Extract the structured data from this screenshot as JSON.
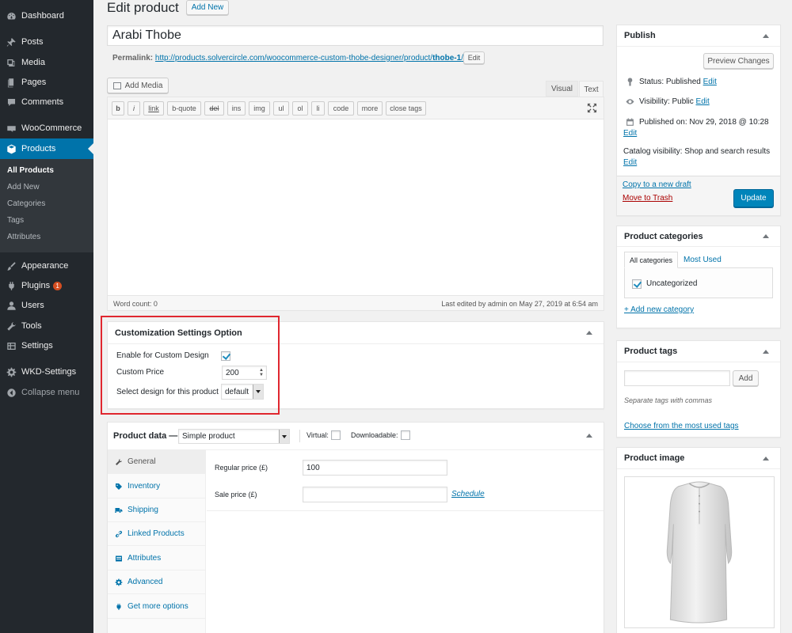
{
  "sidebar": {
    "items": [
      {
        "label": "Dashboard",
        "icon": "dashboard-icon"
      },
      {
        "label": "Posts",
        "icon": "pin-icon"
      },
      {
        "label": "Media",
        "icon": "media-icon"
      },
      {
        "label": "Pages",
        "icon": "pages-icon"
      },
      {
        "label": "Comments",
        "icon": "comment-icon"
      },
      {
        "label": "WooCommerce",
        "icon": "woocommerce-icon"
      },
      {
        "label": "Products",
        "icon": "products-box-icon"
      },
      {
        "label": "Appearance",
        "icon": "paintbrush-icon"
      },
      {
        "label": "Plugins",
        "icon": "plug-icon",
        "badge": "1"
      },
      {
        "label": "Users",
        "icon": "user-icon"
      },
      {
        "label": "Tools",
        "icon": "wrench-icon"
      },
      {
        "label": "Settings",
        "icon": "settings-icon"
      },
      {
        "label": "WKD-Settings",
        "icon": "gear-icon"
      }
    ],
    "submenu": [
      "All Products",
      "Add New",
      "Categories",
      "Tags",
      "Attributes"
    ],
    "collapse_label": "Collapse menu"
  },
  "header": {
    "title": "Edit product",
    "add_new": "Add New"
  },
  "title_input": {
    "value": "Arabi Thobe"
  },
  "permalink": {
    "label": "Permalink:",
    "url_prefix": "http://products.solvercircle.com/woocommerce-custom-thobe-designer/product/",
    "slug": "thobe-1",
    "url_suffix": "/",
    "edit_label": "Edit"
  },
  "editor": {
    "add_media": "Add Media",
    "tab_visual": "Visual",
    "tab_text": "Text",
    "quicktags": [
      "b",
      "i",
      "link",
      "b-quote",
      "del",
      "ins",
      "img",
      "ul",
      "ol",
      "li",
      "code",
      "more",
      "close tags"
    ],
    "word_count": "Word count: 0",
    "last_edited": "Last edited by admin on May 27, 2019 at 6:54 am"
  },
  "custom_box": {
    "title": "Customization Settings Option",
    "enable_label": "Enable for Custom Design",
    "enable_checked": true,
    "price_label": "Custom Price",
    "price_value": "200",
    "design_label": "Select design for this product",
    "design_value": "default"
  },
  "product_data": {
    "label": "Product data —",
    "type_value": "Simple product",
    "virtual_label": "Virtual:",
    "downloadable_label": "Downloadable:",
    "tabs": [
      "General",
      "Inventory",
      "Shipping",
      "Linked Products",
      "Attributes",
      "Advanced",
      "Get more options"
    ],
    "regular_price_label": "Regular price (£)",
    "regular_price_value": "100",
    "sale_price_label": "Sale price (£)",
    "sale_price_value": "",
    "schedule_label": "Schedule"
  },
  "publish": {
    "title": "Publish",
    "preview_label": "Preview Changes",
    "status_label": "Status:",
    "status_value": "Published",
    "visibility_label": "Visibility:",
    "visibility_value": "Public",
    "published_label": "Published on:",
    "published_value": "Nov 29, 2018 @ 10:28",
    "catalog_label": "Catalog visibility:",
    "catalog_value": "Shop and search results",
    "edit_label": "Edit",
    "copy_draft": "Copy to a new draft",
    "move_trash": "Move to Trash",
    "update_label": "Update"
  },
  "categories": {
    "title": "Product categories",
    "tab_all": "All categories",
    "tab_most_used": "Most Used",
    "items": [
      {
        "label": "Uncategorized",
        "checked": true
      }
    ],
    "add_new": "+ Add new category"
  },
  "tags": {
    "title": "Product tags",
    "input_value": "",
    "add_label": "Add",
    "hint": "Separate tags with commas",
    "choose_link": "Choose from the most used tags"
  },
  "product_image": {
    "title": "Product image",
    "alt": "white thobe garment"
  },
  "colors": {
    "sidebar_bg": "#23282d",
    "sidebar_active": "#0073aa",
    "link": "#0073aa",
    "primary_button": "#0085ba",
    "highlight_border": "#e0272f",
    "trash_link": "#a00"
  }
}
